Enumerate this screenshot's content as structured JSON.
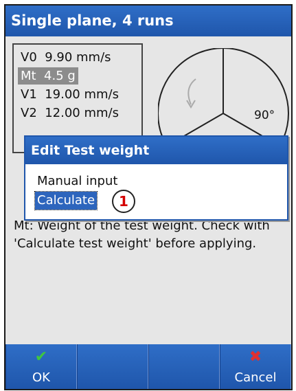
{
  "window": {
    "title": "Single plane, 4 runs"
  },
  "readings": [
    {
      "label": "V0  9.90 mm/s",
      "selected": false
    },
    {
      "label": "Mt  4.5 g",
      "selected": true
    },
    {
      "label": "V1  19.00 mm/s",
      "selected": false
    },
    {
      "label": "V2  12.00 mm/s",
      "selected": false
    }
  ],
  "gauge": {
    "angle_label": "90°"
  },
  "hint_text": "Mt: Weight of the test weight. Check with 'Calculate test weight' before applying.",
  "dialog": {
    "title": "Edit Test weight",
    "options": [
      {
        "label": "Manual input",
        "selected": false
      },
      {
        "label": "Calculate",
        "selected": true
      }
    ]
  },
  "marker": {
    "number": "1"
  },
  "toolbar": {
    "ok_label": "OK",
    "cancel_label": "Cancel",
    "ok_icon": "check-icon",
    "cancel_icon": "close-icon"
  },
  "colors": {
    "accent": "#1f56ab",
    "ok": "#3fc73f",
    "cancel": "#e03030",
    "marker": "#d40000"
  }
}
